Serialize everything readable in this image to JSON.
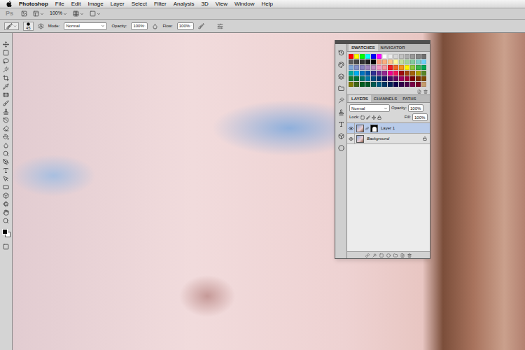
{
  "menu_bar": {
    "app": "Photoshop",
    "items": [
      "File",
      "Edit",
      "Image",
      "Layer",
      "Select",
      "Filter",
      "Analysis",
      "3D",
      "View",
      "Window",
      "Help"
    ]
  },
  "app_bar": {
    "logo": "Ps",
    "zoom": "100%"
  },
  "options_bar": {
    "brush_size": "45",
    "mode_label": "Mode:",
    "mode": "Normal",
    "opacity_label": "Opacity:",
    "opacity": "100%",
    "flow_label": "Flow:",
    "flow": "100%"
  },
  "swatches_panel": {
    "tabs": [
      {
        "label": "SWATCHES",
        "selected": true
      },
      {
        "label": "NAVIGATOR",
        "selected": false
      }
    ],
    "swatches": [
      {
        "color": "#ff0000"
      },
      {
        "color": "#ffff00"
      },
      {
        "color": "#00ff00"
      },
      {
        "color": "#00ffff"
      },
      {
        "color": "#0000ff"
      },
      {
        "color": "#ff00ff"
      },
      {
        "color": "#ffffff"
      },
      {
        "color": "#ebebeb"
      },
      {
        "color": "#d6d6d6"
      },
      {
        "color": "#c2c2c2"
      },
      {
        "color": "#adadad"
      },
      {
        "color": "#999999"
      },
      {
        "color": "#858585"
      },
      {
        "color": "#707070"
      },
      {
        "color": "#5c5c5c"
      },
      {
        "color": "#474747"
      },
      {
        "color": "#333333"
      },
      {
        "color": "#1f1f1f"
      },
      {
        "color": "#000000"
      },
      {
        "color": "#f7977a"
      },
      {
        "color": "#f9ad81"
      },
      {
        "color": "#fdc68a"
      },
      {
        "color": "#fff79a"
      },
      {
        "color": "#c4df9b"
      },
      {
        "color": "#a2d39c"
      },
      {
        "color": "#82ca9d"
      },
      {
        "color": "#7bcdc8"
      },
      {
        "color": "#6ecff6"
      },
      {
        "color": "#7ea7d8"
      },
      {
        "color": "#8493ca"
      },
      {
        "color": "#8882be"
      },
      {
        "color": "#a187be"
      },
      {
        "color": "#bc8dbf"
      },
      {
        "color": "#f49ac2"
      },
      {
        "color": "#f6989d"
      },
      {
        "color": "#ed1c24"
      },
      {
        "color": "#f26522"
      },
      {
        "color": "#f7941d"
      },
      {
        "color": "#fff200"
      },
      {
        "color": "#8dc73f"
      },
      {
        "color": "#39b54a"
      },
      {
        "color": "#00a651"
      },
      {
        "color": "#00a99d"
      },
      {
        "color": "#00aeef"
      },
      {
        "color": "#0072bc"
      },
      {
        "color": "#0054a6"
      },
      {
        "color": "#2e3192"
      },
      {
        "color": "#662d91"
      },
      {
        "color": "#92278f"
      },
      {
        "color": "#ec008c"
      },
      {
        "color": "#ed145b"
      },
      {
        "color": "#9e0b0f"
      },
      {
        "color": "#a0410d"
      },
      {
        "color": "#a36209"
      },
      {
        "color": "#aba000"
      },
      {
        "color": "#598527"
      },
      {
        "color": "#1a7b30"
      },
      {
        "color": "#007236"
      },
      {
        "color": "#00746b"
      },
      {
        "color": "#0076a3"
      },
      {
        "color": "#004b80"
      },
      {
        "color": "#003471"
      },
      {
        "color": "#1b1464"
      },
      {
        "color": "#440e62"
      },
      {
        "color": "#630460"
      },
      {
        "color": "#9e005d"
      },
      {
        "color": "#9e0039"
      },
      {
        "color": "#790000"
      },
      {
        "color": "#7b2e00"
      },
      {
        "color": "#7d4900"
      },
      {
        "color": "#827b00"
      },
      {
        "color": "#406618"
      },
      {
        "color": "#005e20"
      },
      {
        "color": "#005826"
      },
      {
        "color": "#005952"
      },
      {
        "color": "#005b7f"
      },
      {
        "color": "#003663"
      },
      {
        "color": "#002157"
      },
      {
        "color": "#0d004c"
      },
      {
        "color": "#32004b"
      },
      {
        "color": "#4b0049"
      },
      {
        "color": "#7b0046"
      },
      {
        "color": "#7a0026"
      },
      {
        "color": "#c69c6d"
      }
    ]
  },
  "layers_panel": {
    "tabs": [
      {
        "label": "LAYERS",
        "selected": true
      },
      {
        "label": "CHANNELS",
        "selected": false
      },
      {
        "label": "PATHS",
        "selected": false
      }
    ],
    "blend_mode": "Normal",
    "opacity_label": "Opacity:",
    "opacity": "100%",
    "lock_label": "Lock:",
    "fill_label": "Fill:",
    "fill": "100%",
    "layers": [
      {
        "name": "Layer 1",
        "visible": true,
        "selected": true,
        "has_mask": true,
        "locked": false
      },
      {
        "name": "Background",
        "visible": true,
        "selected": false,
        "has_mask": false,
        "locked": true
      }
    ]
  }
}
